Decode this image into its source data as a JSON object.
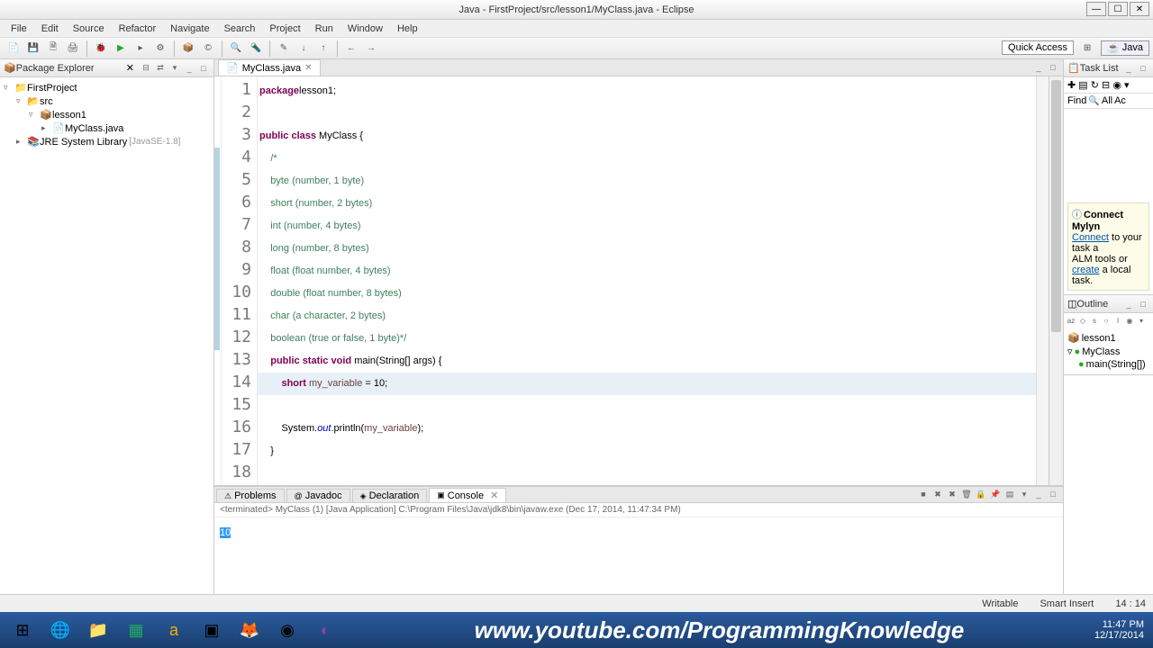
{
  "titlebar": {
    "title": "Java - FirstProject/src/lesson1/MyClass.java - Eclipse"
  },
  "menu": [
    "File",
    "Edit",
    "Source",
    "Refactor",
    "Navigate",
    "Search",
    "Project",
    "Run",
    "Window",
    "Help"
  ],
  "quick_access": "Quick Access",
  "perspective": "Java",
  "package_explorer": {
    "title": "Package Explorer",
    "project": "FirstProject",
    "src": "src",
    "pkg": "lesson1",
    "file": "MyClass.java",
    "jre": "JRE System Library",
    "jre_ver": "[JavaSE-1.8]"
  },
  "editor": {
    "tab": "MyClass.java",
    "lines": [
      {
        "n": "1",
        "seg": [
          [
            "kw",
            "package"
          ],
          [
            "",
            ""
          ],
          [
            "",
            "lesson1;"
          ]
        ]
      },
      {
        "n": "2",
        "seg": [
          [
            "",
            ""
          ]
        ]
      },
      {
        "n": "3",
        "seg": [
          [
            "kw",
            "public"
          ],
          [
            "",
            " "
          ],
          [
            "kw",
            "class"
          ],
          [
            "",
            " "
          ],
          [
            "cls",
            "MyClass"
          ],
          [
            "",
            " {"
          ]
        ]
      },
      {
        "n": "4",
        "seg": [
          [
            "",
            "    "
          ],
          [
            "cm",
            "/*"
          ]
        ]
      },
      {
        "n": "5",
        "seg": [
          [
            "",
            "    "
          ],
          [
            "cm",
            "byte (number, 1 byte)"
          ]
        ]
      },
      {
        "n": "6",
        "seg": [
          [
            "",
            "    "
          ],
          [
            "cm",
            "short (number, 2 bytes)"
          ]
        ]
      },
      {
        "n": "7",
        "seg": [
          [
            "",
            "    "
          ],
          [
            "cm",
            "int (number, 4 bytes)"
          ]
        ]
      },
      {
        "n": "8",
        "seg": [
          [
            "",
            "    "
          ],
          [
            "cm",
            "long (number, 8 bytes)"
          ]
        ]
      },
      {
        "n": "9",
        "seg": [
          [
            "",
            "    "
          ],
          [
            "cm",
            "float (float number, 4 bytes)"
          ]
        ]
      },
      {
        "n": "10",
        "seg": [
          [
            "",
            "    "
          ],
          [
            "cm",
            "double (float number, 8 bytes)"
          ]
        ]
      },
      {
        "n": "11",
        "seg": [
          [
            "",
            "    "
          ],
          [
            "cm",
            "char (a character, 2 bytes)"
          ]
        ]
      },
      {
        "n": "12",
        "seg": [
          [
            "",
            "    "
          ],
          [
            "cm",
            "boolean (true or false, 1 byte)*/"
          ]
        ]
      },
      {
        "n": "13",
        "seg": [
          [
            "",
            "    "
          ],
          [
            "kw",
            "public"
          ],
          [
            "",
            " "
          ],
          [
            "kw",
            "static"
          ],
          [
            "",
            " "
          ],
          [
            "kw",
            "void"
          ],
          [
            "",
            " "
          ],
          [
            "cls",
            "main"
          ],
          [
            "",
            "(String[] args) {"
          ]
        ]
      },
      {
        "n": "14",
        "seg": [
          [
            "",
            "        "
          ],
          [
            "kw",
            "short"
          ],
          [
            "",
            " "
          ],
          [
            "var",
            "my_variable"
          ],
          [
            "",
            " = 10;"
          ]
        ],
        "current": true
      },
      {
        "n": "15",
        "seg": [
          [
            "",
            ""
          ]
        ]
      },
      {
        "n": "16",
        "seg": [
          [
            "",
            "        "
          ],
          [
            "",
            "System."
          ],
          [
            "fld",
            "out"
          ],
          [
            "",
            ".println("
          ],
          [
            "var",
            "my_variable"
          ],
          [
            "",
            ");"
          ]
        ]
      },
      {
        "n": "17",
        "seg": [
          [
            "",
            "    }"
          ]
        ]
      },
      {
        "n": "18",
        "seg": [
          [
            "",
            ""
          ]
        ]
      }
    ]
  },
  "task_list": {
    "title": "Task List",
    "find": "Find",
    "all": "All",
    "ac": "Ac",
    "connect_title": "Connect Mylyn",
    "connect_text1": "Connect",
    "connect_text2": " to your task a",
    "connect_text3": "ALM tools or ",
    "connect_text4": "create",
    "connect_text5": " a local task."
  },
  "outline": {
    "title": "Outline",
    "pkg": "lesson1",
    "cls": "MyClass",
    "method": "main(String[])"
  },
  "bottom": {
    "tabs": [
      "Problems",
      "Javadoc",
      "Declaration",
      "Console"
    ],
    "meta": "<terminated> MyClass (1) [Java Application] C:\\Program Files\\Java\\jdk8\\bin\\javaw.exe (Dec 17, 2014, 11:47:34 PM)",
    "output": "10"
  },
  "status": {
    "writable": "Writable",
    "insert": "Smart Insert",
    "pos": "14 : 14"
  },
  "taskbar": {
    "url": "www.youtube.com/ProgrammingKnowledge",
    "time": "11:47 PM",
    "date": "12/17/2014"
  }
}
